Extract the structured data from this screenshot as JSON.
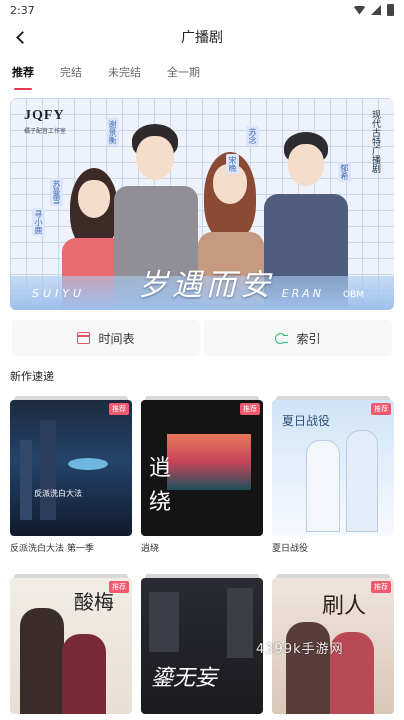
{
  "status": {
    "time": "2:37"
  },
  "header": {
    "title": "广播剧"
  },
  "tabs": [
    {
      "label": "推荐"
    },
    {
      "label": "完结"
    },
    {
      "label": "未完结"
    },
    {
      "label": "全一期"
    }
  ],
  "banner": {
    "logo": "JQFY",
    "logo_sub": "橘子配音工作室",
    "vertical_text": "现代古特广播剧",
    "names": [
      "寻小鹿",
      "苏曼雪",
      "谢景衡",
      "苏念",
      "宋晚",
      "郁希"
    ],
    "title_art": "岁遇而安",
    "bottom_left": "SUIYU",
    "bottom_right": "ERAN",
    "bottom_logo": "OBM"
  },
  "actions": [
    {
      "label": "时间表",
      "icon": "calendar-icon"
    },
    {
      "label": "索引",
      "icon": "index-icon"
    }
  ],
  "section": {
    "title": "新作速递"
  },
  "cards": [
    {
      "title": "反派洗白大法 第一季",
      "badge": "推荐"
    },
    {
      "title": "逍绕",
      "badge": "推荐"
    },
    {
      "title": "夏日战役",
      "badge": "推荐"
    },
    {
      "title": "",
      "badge": "推荐",
      "art": "酸梅"
    },
    {
      "title": "",
      "badge": "",
      "art": "鎏无妄"
    },
    {
      "title": "",
      "badge": "推荐",
      "art": "刷人"
    }
  ],
  "card_art": {
    "c2": "逍",
    "c2b": "绕",
    "c3": "夏日战役",
    "c1": "反派洗白大法"
  },
  "watermark": "4399k手游网"
}
